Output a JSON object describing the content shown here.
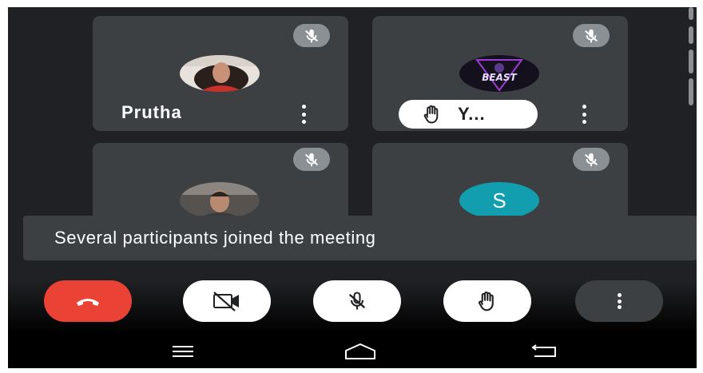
{
  "participants": [
    {
      "name": "Prutha",
      "mic": "mic-off-icon",
      "avatar": "photo",
      "hand_raised": false
    },
    {
      "name": "Y...",
      "mic": "mic-off-icon",
      "avatar": "logo",
      "avatar_logo_text": "BEAST",
      "hand_raised": true
    },
    {
      "name": "",
      "mic": "mic-off-icon",
      "avatar": "photo",
      "hand_raised": false
    },
    {
      "name": "",
      "mic": "mic-off-icon",
      "avatar": "initial",
      "initial": "S",
      "hand_raised": false
    }
  ],
  "snackbar": {
    "text": "Several participants joined the meeting"
  },
  "controls": [
    {
      "action": "end-call",
      "icon": "phone-hangup-icon",
      "bg": "#ea4335"
    },
    {
      "action": "camera",
      "icon": "camera-off-icon",
      "bg": "#ffffff"
    },
    {
      "action": "microphone",
      "icon": "mic-off-icon",
      "bg": "#ffffff"
    },
    {
      "action": "raise-hand",
      "icon": "hand-icon",
      "bg": "#ffffff"
    },
    {
      "action": "more-options",
      "icon": "more-vert-icon",
      "bg": "#3c4043"
    }
  ],
  "navbar": [
    "menu-icon",
    "home-icon",
    "back-icon"
  ],
  "colors": {
    "background": "#202124",
    "tile": "#3c4043",
    "end_call": "#ea4335",
    "initial_avatar": "#129eaf",
    "mic_badge": "#8b9094"
  }
}
